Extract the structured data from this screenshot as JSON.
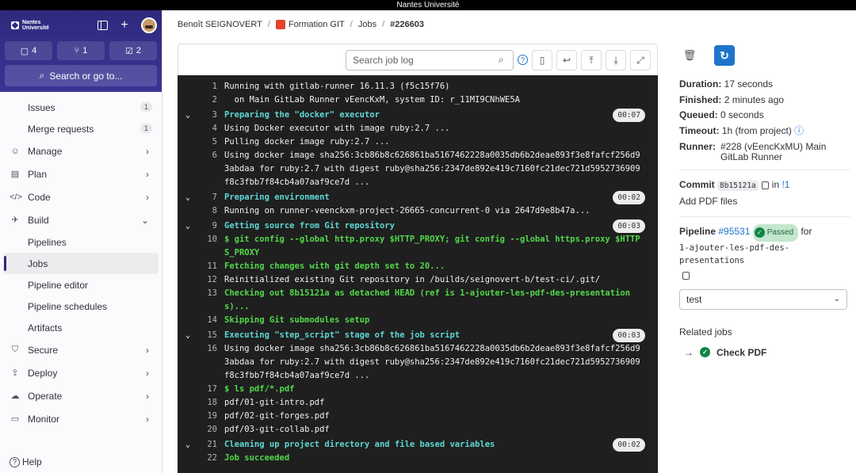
{
  "topbar": {
    "title": "Nantes Université"
  },
  "sidebar": {
    "logo_text": "Nantes Université",
    "counts": [
      {
        "icon": "issues-icon",
        "value": "4"
      },
      {
        "icon": "merge-request-icon",
        "value": "1"
      },
      {
        "icon": "todo-icon",
        "value": "2"
      }
    ],
    "search_label": "Search or go to...",
    "items": [
      {
        "label": "Issues",
        "badge": "1"
      },
      {
        "label": "Merge requests",
        "badge": "1"
      }
    ],
    "sections": [
      {
        "label": "Manage",
        "icon": "users-icon"
      },
      {
        "label": "Plan",
        "icon": "calendar-icon"
      },
      {
        "label": "Code",
        "icon": "code-icon"
      },
      {
        "label": "Build",
        "icon": "rocket-icon"
      }
    ],
    "build_items": [
      "Pipelines",
      "Jobs",
      "Pipeline editor",
      "Pipeline schedules",
      "Artifacts"
    ],
    "sections2": [
      {
        "label": "Secure",
        "icon": "shield-icon"
      },
      {
        "label": "Deploy",
        "icon": "deploy-icon"
      },
      {
        "label": "Operate",
        "icon": "cloud-icon"
      },
      {
        "label": "Monitor",
        "icon": "monitor-icon"
      }
    ],
    "help_label": "Help"
  },
  "breadcrumb": {
    "items": [
      "Benoît SEIGNOVERT",
      "Formation GIT",
      "Jobs",
      "#226603"
    ]
  },
  "log_search": {
    "placeholder": "Search job log"
  },
  "log": [
    {
      "n": "1",
      "t": "Running with gitlab-runner 16.11.3 (f5c15f76)",
      "c": "white"
    },
    {
      "n": "2",
      "t": "  on Main GitLab Runner vEencKxM, system ID: r_11MI9CNhWE5A",
      "c": "white"
    },
    {
      "n": "3",
      "t": "Preparing the \"docker\" executor",
      "c": "cyan",
      "time": "00:07",
      "tog": true
    },
    {
      "n": "4",
      "t": "Using Docker executor with image ruby:2.7 ...",
      "c": "white"
    },
    {
      "n": "5",
      "t": "Pulling docker image ruby:2.7 ...",
      "c": "white"
    },
    {
      "n": "6",
      "t": "Using docker image sha256:3cb86b8c626861ba5167462228a0035db6b2deae893f3e8fafcf256d93abdaa for ruby:2.7 with digest ruby@sha256:2347de892e419c7160fc21dec721d5952736909f8c3fbb7f84cb4a07aaf9ce7d ...",
      "c": "white"
    },
    {
      "n": "7",
      "t": "Preparing environment",
      "c": "cyan",
      "time": "00:02",
      "tog": true
    },
    {
      "n": "8",
      "t": "Running on runner-veenckxm-project-26665-concurrent-0 via 2647d9e8b47a...",
      "c": "white"
    },
    {
      "n": "9",
      "t": "Getting source from Git repository",
      "c": "cyan",
      "time": "00:03",
      "tog": true
    },
    {
      "n": "10",
      "t": "$ git config --global http.proxy $HTTP_PROXY; git config --global https.proxy $HTTPS_PROXY",
      "c": "green"
    },
    {
      "n": "11",
      "t": "Fetching changes with git depth set to 20...",
      "c": "green"
    },
    {
      "n": "12",
      "t": "Reinitialized existing Git repository in /builds/seignovert-b/test-ci/.git/",
      "c": "white"
    },
    {
      "n": "13",
      "t": "Checking out 8b15121a as detached HEAD (ref is 1-ajouter-les-pdf-des-presentations)...",
      "c": "green"
    },
    {
      "n": "14",
      "t": "Skipping Git submodules setup",
      "c": "green"
    },
    {
      "n": "15",
      "t": "Executing \"step_script\" stage of the job script",
      "c": "cyan",
      "time": "00:03",
      "tog": true
    },
    {
      "n": "16",
      "t": "Using docker image sha256:3cb86b8c626861ba5167462228a0035db6b2deae893f3e8fafcf256d93abdaa for ruby:2.7 with digest ruby@sha256:2347de892e419c7160fc21dec721d5952736909f8c3fbb7f84cb4a07aaf9ce7d ...",
      "c": "white"
    },
    {
      "n": "17",
      "t": "$ ls pdf/*.pdf",
      "c": "green"
    },
    {
      "n": "18",
      "t": "pdf/01-git-intro.pdf",
      "c": "white"
    },
    {
      "n": "19",
      "t": "pdf/02-git-forges.pdf",
      "c": "white"
    },
    {
      "n": "20",
      "t": "pdf/03-git-collab.pdf",
      "c": "white"
    },
    {
      "n": "21",
      "t": "Cleaning up project directory and file based variables",
      "c": "cyan",
      "time": "00:02",
      "tog": true
    },
    {
      "n": "22",
      "t": "Job succeeded",
      "c": "green"
    }
  ],
  "details": {
    "duration_label": "Duration:",
    "duration": "17 seconds",
    "finished_label": "Finished:",
    "finished": "2 minutes ago",
    "queued_label": "Queued:",
    "queued": "0 seconds",
    "timeout_label": "Timeout:",
    "timeout": "1h (from project)",
    "runner_label": "Runner:",
    "runner": "#228 (vEencKxMU) Main GitLab Runner",
    "commit_label": "Commit",
    "commit_sha": "8b15121a",
    "commit_in": "in",
    "commit_mr": "!1",
    "commit_title": "Add PDF files",
    "pipeline_label": "Pipeline",
    "pipeline_id": "#95531",
    "pipeline_status": "Passed",
    "pipeline_for": "for",
    "pipeline_ref": "1-ajouter-les-pdf-des-presentations",
    "stage_select": "test",
    "related_label": "Related jobs",
    "related_job": "Check PDF"
  }
}
